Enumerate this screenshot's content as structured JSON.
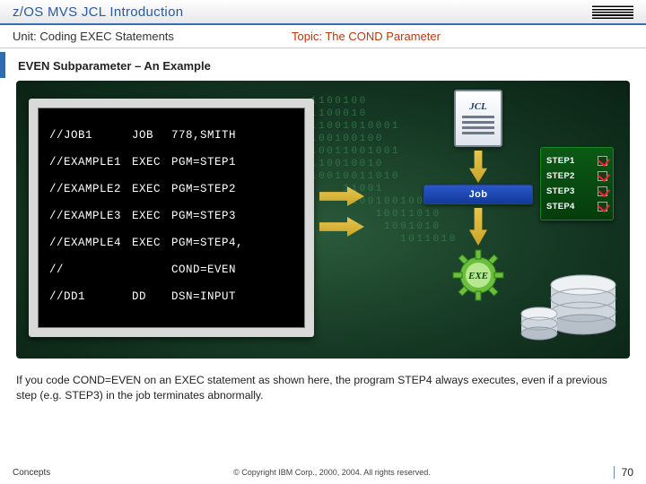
{
  "header": {
    "title": "z/OS MVS JCL Introduction",
    "unit_label": "Unit: Coding EXEC Statements",
    "topic_label": "Topic: The COND Parameter"
  },
  "section_title": "EVEN Subparameter – An Example",
  "code": {
    "rows": [
      {
        "c1": "//JOB1",
        "c2": "JOB",
        "c3": "778,SMITH"
      },
      {
        "c1": "//EXAMPLE1",
        "c2": "EXEC",
        "c3": "PGM=STEP1"
      },
      {
        "c1": "//EXAMPLE2",
        "c2": "EXEC",
        "c3": "PGM=STEP2"
      },
      {
        "c1": "//EXAMPLE3",
        "c2": "EXEC",
        "c3": "PGM=STEP3"
      },
      {
        "c1": "//EXAMPLE4",
        "c2": "EXEC",
        "c3": "PGM=STEP4,"
      },
      {
        "c1": "//",
        "c2": "",
        "c3": "COND=EVEN"
      },
      {
        "c1": "//DD1",
        "c2": "DD",
        "c3": "DSN=INPUT"
      }
    ]
  },
  "diagram": {
    "jcl_label": "JCL",
    "job_label": "Job",
    "exe_label": "EXE",
    "steps": [
      "STEP1",
      "STEP2",
      "STEP3",
      "STEP4"
    ],
    "binary_bg": "1100100\n1100010\n11001010001\n100100100\n10011001001\n110010010\n10010011010\n    11001\n     1001001001\n        10011010\n         1001010\n           1011010"
  },
  "note": "If you code COND=EVEN on an EXEC statement as shown here, the program STEP4 always executes, even if a previous step (e.g. STEP3) in the job terminates abnormally.",
  "footer": {
    "left": "Concepts",
    "center": "© Copyright IBM Corp., 2000, 2004. All rights reserved.",
    "page": "70"
  }
}
